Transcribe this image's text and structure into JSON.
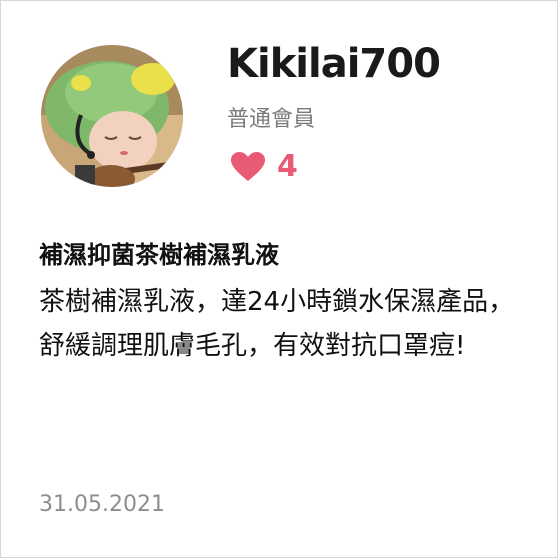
{
  "profile": {
    "username": "Kikilai700",
    "role": "普通會員",
    "likes": "4"
  },
  "post": {
    "title": "補濕抑菌茶樹補濕乳液",
    "description": "茶樹補濕乳液，達24小時鎖水保濕產品，舒緩調理肌膚毛孔，有效對抗口罩痘!",
    "date": "31.05.2021"
  },
  "colors": {
    "accent": "#e95b75",
    "muted": "#8e8e8e"
  },
  "icons": {
    "avatar": "avatar-image",
    "like": "heart-icon"
  }
}
